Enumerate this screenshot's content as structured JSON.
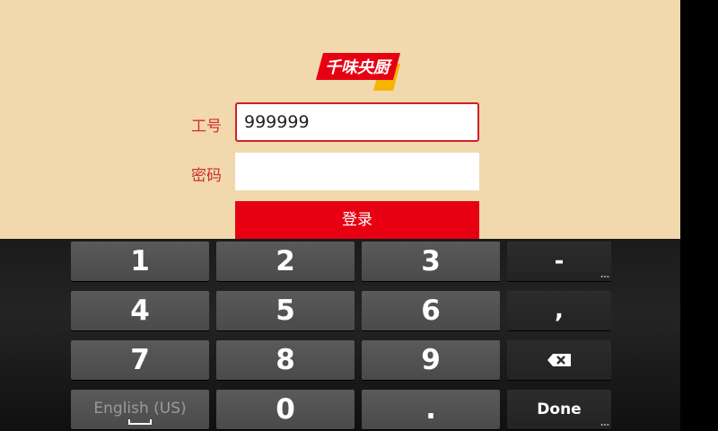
{
  "app": {
    "logo_text": "千味央厨",
    "employee_id_label": "工号",
    "employee_id_value": "999999",
    "password_label": "密码",
    "password_value": "",
    "login_button": "登录"
  },
  "keyboard": {
    "keys": [
      "1",
      "2",
      "3",
      "-",
      "4",
      "5",
      "6",
      ",",
      "7",
      "8",
      "9",
      "0",
      "."
    ],
    "language_key": "English (US)",
    "done_key": "Done",
    "delete_icon": "backspace-icon"
  },
  "colors": {
    "background": "#f2d8ad",
    "brand_red": "#e60012",
    "label_red": "#c8322b"
  }
}
